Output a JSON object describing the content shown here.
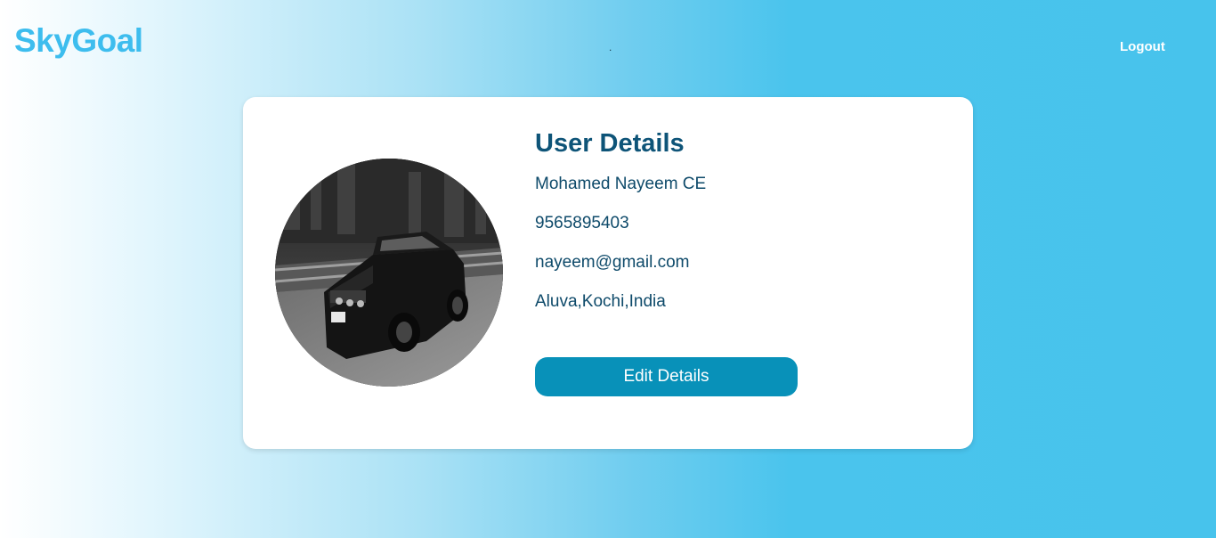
{
  "navbar": {
    "brand": "SkyGoal",
    "center_mark": ".",
    "logout_label": "Logout"
  },
  "profile": {
    "title": "User Details",
    "name": "Mohamed Nayeem CE",
    "phone": "9565895403",
    "email": "nayeem@gmail.com",
    "address": "Aluva,Kochi,India",
    "edit_label": "Edit Details",
    "avatar_icon": "car-photo"
  },
  "colors": {
    "brand": "#3dbdee",
    "heading": "#0e5478",
    "button": "#0891b9",
    "background_end": "#47c3ec"
  }
}
